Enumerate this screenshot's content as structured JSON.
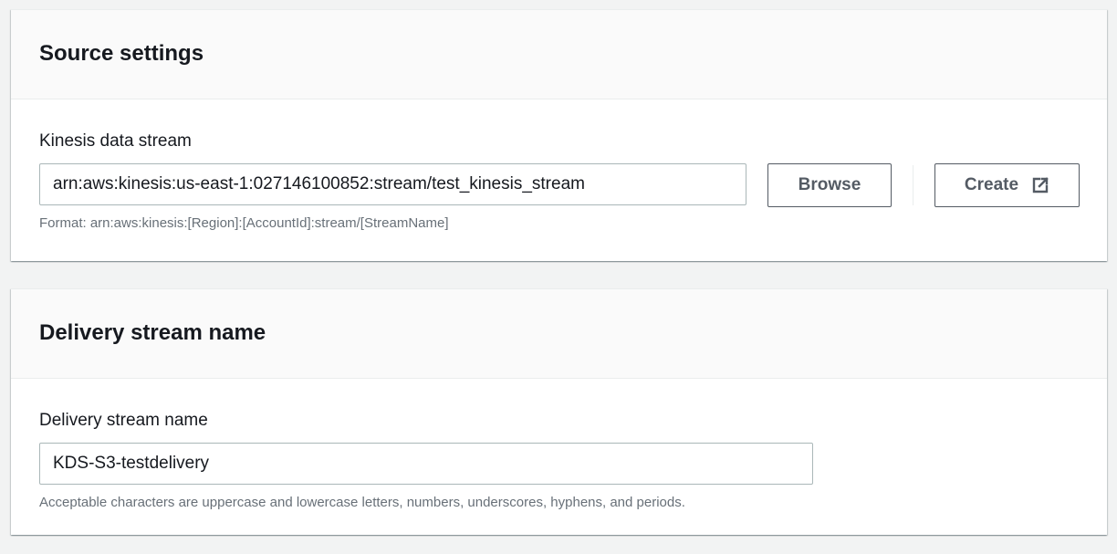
{
  "source_settings": {
    "title": "Source settings",
    "stream_label": "Kinesis data stream",
    "stream_value": "arn:aws:kinesis:us-east-1:027146100852:stream/test_kinesis_stream",
    "format_hint": "Format: arn:aws:kinesis:[Region]:[AccountId]:stream/[StreamName]",
    "browse_label": "Browse",
    "create_label": "Create",
    "create_icon": "external-link-icon"
  },
  "delivery_stream": {
    "title": "Delivery stream name",
    "name_label": "Delivery stream name",
    "name_value": "KDS-S3-testdelivery",
    "name_hint": "Acceptable characters are uppercase and lowercase letters, numbers, underscores, hyphens, and periods."
  },
  "colors": {
    "background": "#f2f3f3",
    "panel": "#ffffff",
    "header": "#fafafa",
    "text": "#16191f",
    "hint": "#687078",
    "button_border": "#545b64",
    "input_border": "#aab7b8"
  }
}
